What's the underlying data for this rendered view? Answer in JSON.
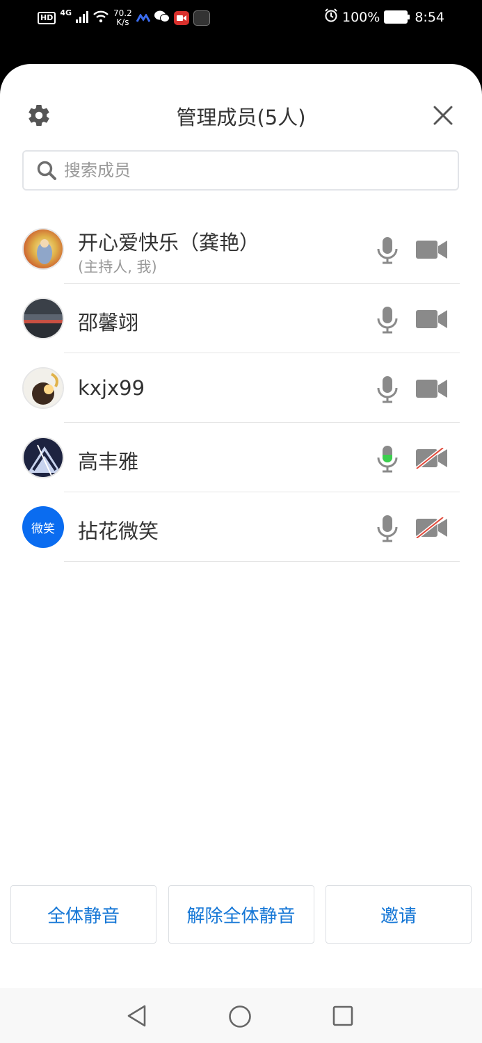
{
  "status_bar": {
    "hd": "HD",
    "network": "4G",
    "speed_value": "70.2",
    "speed_unit": "K/s",
    "battery": "100%",
    "time": "8:54"
  },
  "dialog": {
    "title": "管理成员(5人)",
    "search_placeholder": "搜索成员"
  },
  "members": [
    {
      "name": "开心爱快乐（龚艳）",
      "role": "(主持人, 我)",
      "avatar": "avatar-image",
      "mic": "idle",
      "camera": "on"
    },
    {
      "name": "邵馨翊",
      "avatar": "avatar-image",
      "mic": "idle",
      "camera": "on"
    },
    {
      "name": "kxjx99",
      "avatar": "avatar-image",
      "mic": "idle",
      "camera": "on"
    },
    {
      "name": "高丰雅",
      "avatar": "avatar-image",
      "mic": "speaking",
      "camera": "off"
    },
    {
      "name": "拈花微笑",
      "avatar_text": "微笑",
      "mic": "idle",
      "camera": "off"
    }
  ],
  "actions": {
    "mute_all": "全体静音",
    "unmute_all": "解除全体静音",
    "invite": "邀请"
  },
  "colors": {
    "accent": "#1677d6",
    "avatar_bg": "#0a6cf0",
    "mic_active": "#3ccf4e",
    "camera_off_slash": "#e24a3b",
    "icon_gray": "#8a8a8a"
  }
}
